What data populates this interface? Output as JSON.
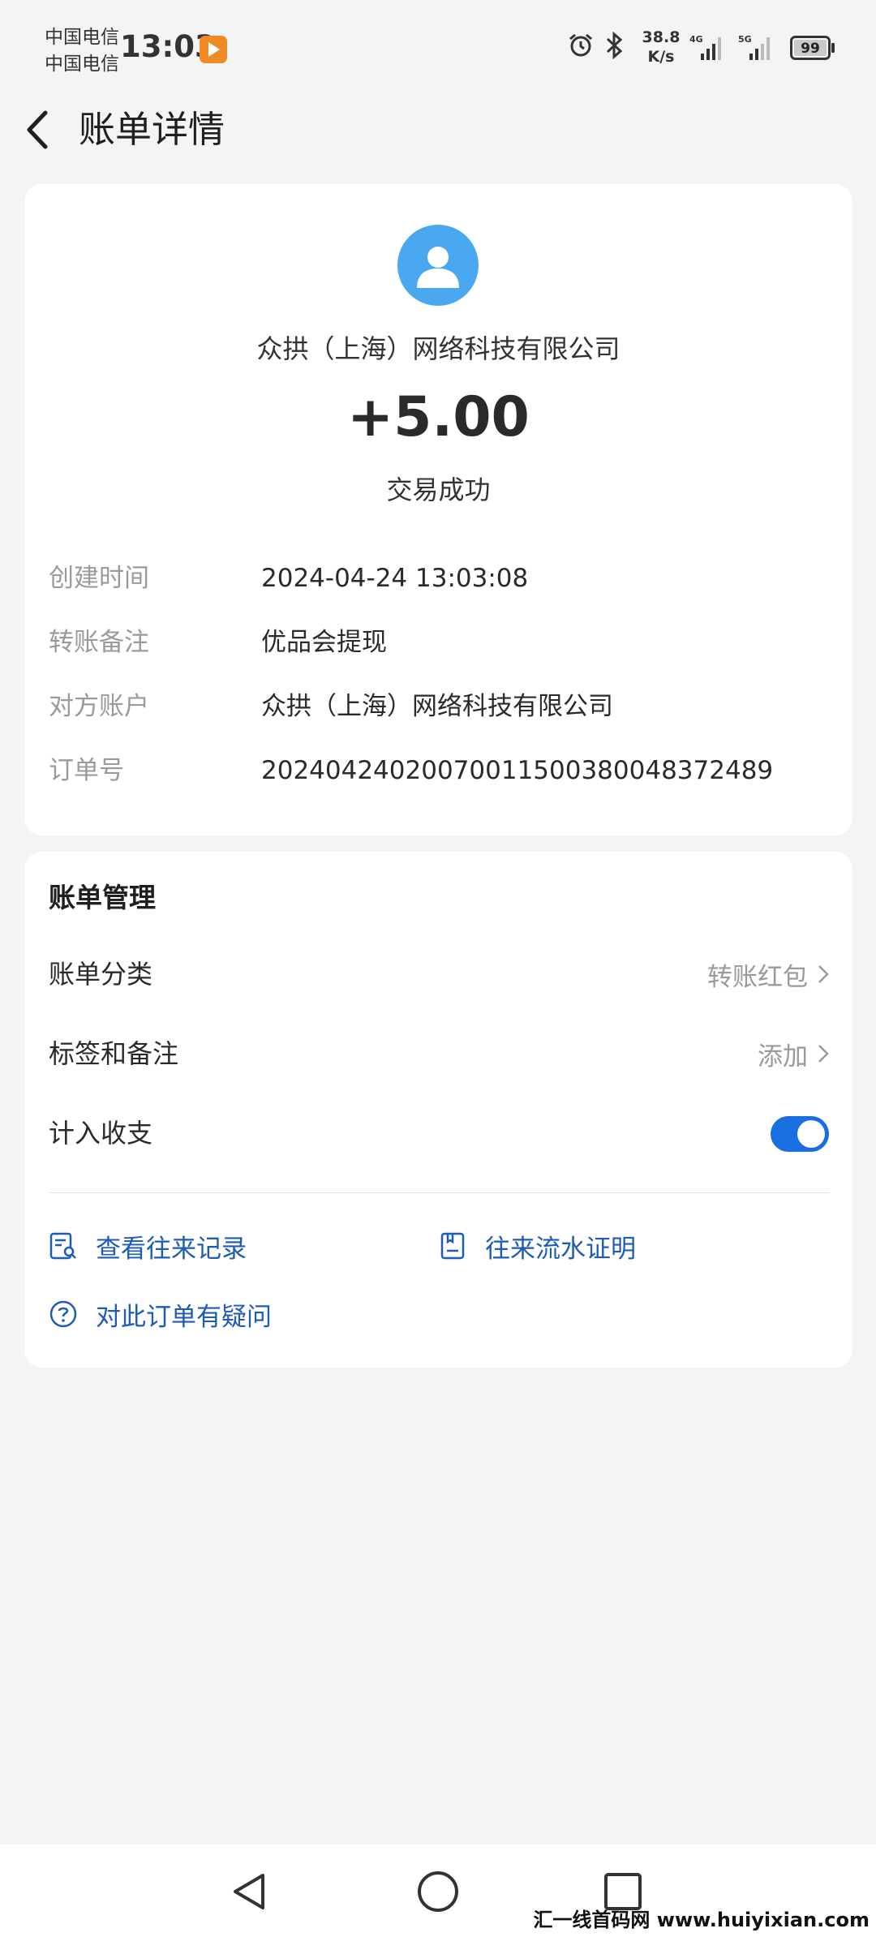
{
  "status_bar": {
    "carrier_1": "中国电信",
    "carrier_2": "中国电信",
    "time": "13:03",
    "net_speed_value": "38.8",
    "net_speed_unit": "K/s",
    "sim1_type": "4G",
    "sim2_type": "5G",
    "battery": "99"
  },
  "header": {
    "title": "账单详情"
  },
  "summary": {
    "merchant": "众拱（上海）网络科技有限公司",
    "amount": "+5.00",
    "status": "交易成功"
  },
  "details": [
    {
      "label": "创建时间",
      "value": "2024-04-24 13:03:08"
    },
    {
      "label": "转账备注",
      "value": "优品会提现"
    },
    {
      "label": "对方账户",
      "value": "众拱（上海）网络科技有限公司"
    },
    {
      "label": "订单号",
      "value": "20240424020070011500380048372489"
    }
  ],
  "management": {
    "title": "账单管理",
    "category_label": "账单分类",
    "category_value": "转账红包",
    "tags_label": "标签和备注",
    "tags_value": "添加",
    "include_label": "计入收支",
    "include_enabled": true,
    "view_records": "查看往来记录",
    "flow_proof": "往来流水证明",
    "question": "对此订单有疑问"
  },
  "watermark": "汇一线首码网 www.huiyixian.com",
  "colors": {
    "accent": "#1a6fe0",
    "link": "#1e5bb8",
    "avatar": "#4aa8f0"
  }
}
